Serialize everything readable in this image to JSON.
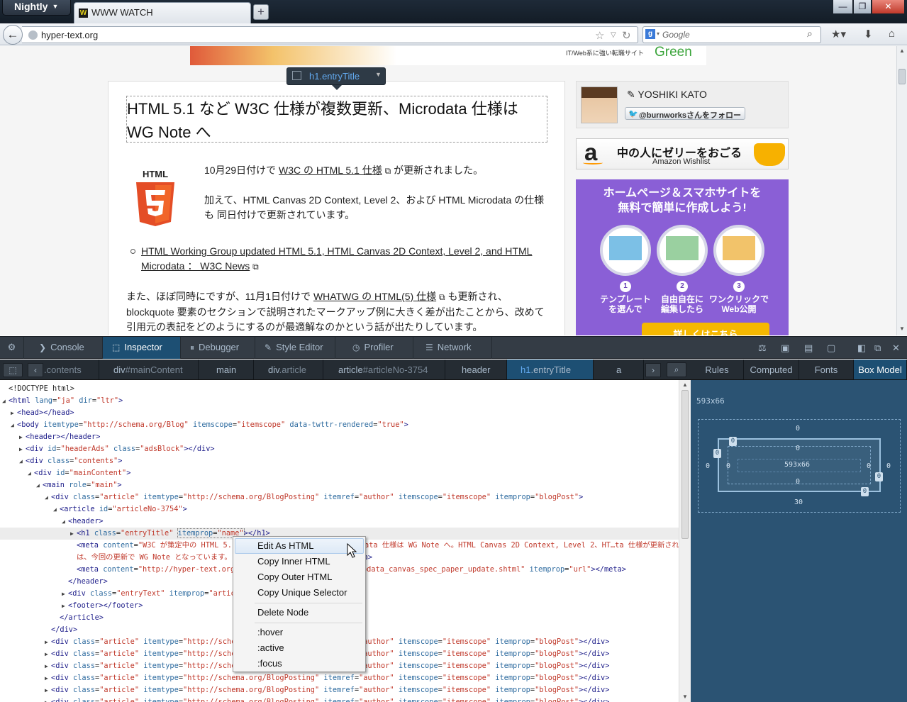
{
  "browser": {
    "app_button": "Nightly",
    "tab_title": "WWW WATCH",
    "tab_favicon": "W",
    "new_tab": "+",
    "url": "hyper-text.org",
    "search_placeholder": "Google",
    "window_buttons": {
      "minimize": "—",
      "maximize": "❐",
      "close": "✕"
    }
  },
  "page": {
    "banner_text": "IT/Web系に強い転職サイト",
    "banner_logo": "Green",
    "infobar": {
      "tag": "h1",
      "cls": ".entryTitle"
    },
    "article": {
      "title": "HTML 5.1 など W3C 仕様が複数更新、Microdata 仕様は WG Note へ",
      "p1_a": "10月29日付けで ",
      "p1_link": "W3C の HTML 5.1 仕様",
      "p1_b": " が更新されました。",
      "p2": "加えて、HTML Canvas 2D Context, Level 2、および HTML Microdata の仕様も 同日付けで更新されています。",
      "li_link": "HTML Working Group updated HTML 5.1, HTML Canvas 2D Context, Level 2, and HTML Microdata ： W3C News",
      "p3_a": "また、ほぼ同時にですが、11月1日付けで ",
      "p3_link": "WHATWG の HTML(5) 仕様",
      "p3_b": " も更新され、blockquote 要素のセクションで説明されたマークアップ例に大きく差が出たことから、改めて引用元の表記をどのようにするのが最適解なのかという話が出たりしています。",
      "logo_text": "HTML"
    },
    "sidebar": {
      "author": "YOSHIKI KATO",
      "follow": "@burnworksさんをフォロー",
      "wish_title": "中の人にゼリーをおごる",
      "wish_sub": "Amazon Wishlist",
      "ad_title": "ホームページ＆スマホサイトを\n無料で簡単に作成しよう!",
      "steps": [
        {
          "num": "1",
          "label": "テンプレート\nを選んで"
        },
        {
          "num": "2",
          "label": "自由自在に\n編集したら"
        },
        {
          "num": "3",
          "label": "ワンクリックで\nWeb公開"
        }
      ],
      "ad_button": "詳しくはこちら"
    }
  },
  "devtools": {
    "tabs": [
      "Console",
      "Inspector",
      "Debugger",
      "Style Editor",
      "Profiler",
      "Network"
    ],
    "selected_tab": "Inspector",
    "breadcrumbs": [
      {
        "tag": "",
        "cls": ".contents"
      },
      {
        "tag": "div",
        "cls": "#mainContent"
      },
      {
        "tag": "main",
        "cls": ""
      },
      {
        "tag": "div",
        "cls": ".article"
      },
      {
        "tag": "article",
        "cls": "#articleNo-3754"
      },
      {
        "tag": "header",
        "cls": ""
      },
      {
        "tag": "h1",
        "cls": ".entryTitle"
      },
      {
        "tag": "a",
        "cls": ""
      }
    ],
    "side_tabs": [
      "Rules",
      "Computed",
      "Fonts",
      "Box Model"
    ],
    "selected_side_tab": "Box Model",
    "box_model": {
      "dimensions": "593x66",
      "content": "593x66",
      "margin": {
        "top": "0",
        "right": "0",
        "bottom": "30",
        "left": "0"
      },
      "border": {
        "top": "0",
        "right": "0",
        "bottom": "0",
        "left": "0"
      },
      "padding": {
        "top": "0",
        "right": "0",
        "bottom": "0",
        "left": "0"
      }
    },
    "context_menu": [
      "Edit As HTML",
      "Copy Inner HTML",
      "Copy Outer HTML",
      "Copy Unique Selector",
      "Delete Node",
      ":hover",
      ":active",
      ":focus"
    ]
  }
}
